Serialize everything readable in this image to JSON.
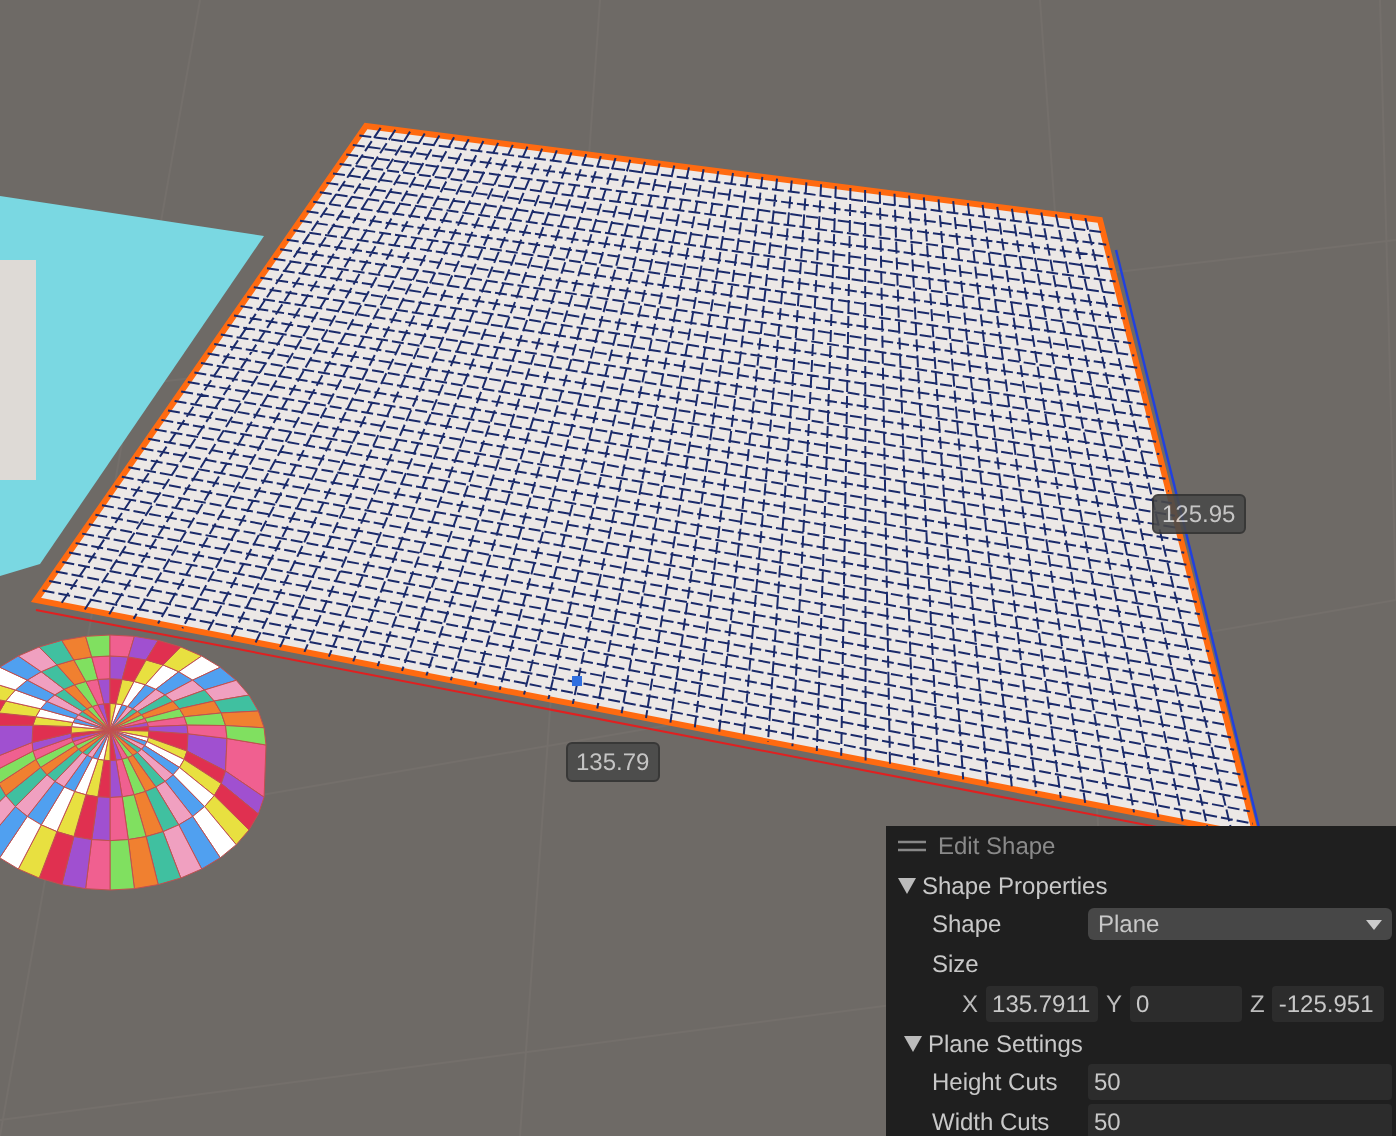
{
  "scene": {
    "dimension_labels": [
      "135.79",
      "125.95"
    ]
  },
  "overlay": {
    "title": "Edit Shape",
    "sections": [
      {
        "title": "Shape Properties",
        "expanded": true,
        "rows": [
          {
            "kind": "dropdown",
            "label": "Shape",
            "value": "Plane"
          },
          {
            "kind": "heading",
            "label": "Size"
          },
          {
            "kind": "vector",
            "fields": [
              {
                "label": "X",
                "value": "135.7911"
              },
              {
                "label": "Y",
                "value": "0"
              },
              {
                "label": "Z",
                "value": "-125.951"
              }
            ]
          }
        ]
      },
      {
        "title": "Plane Settings",
        "expanded": true,
        "rows": [
          {
            "kind": "number",
            "label": "Height Cuts",
            "value": "50"
          },
          {
            "kind": "number",
            "label": "Width Cuts",
            "value": "50"
          }
        ]
      }
    ]
  }
}
